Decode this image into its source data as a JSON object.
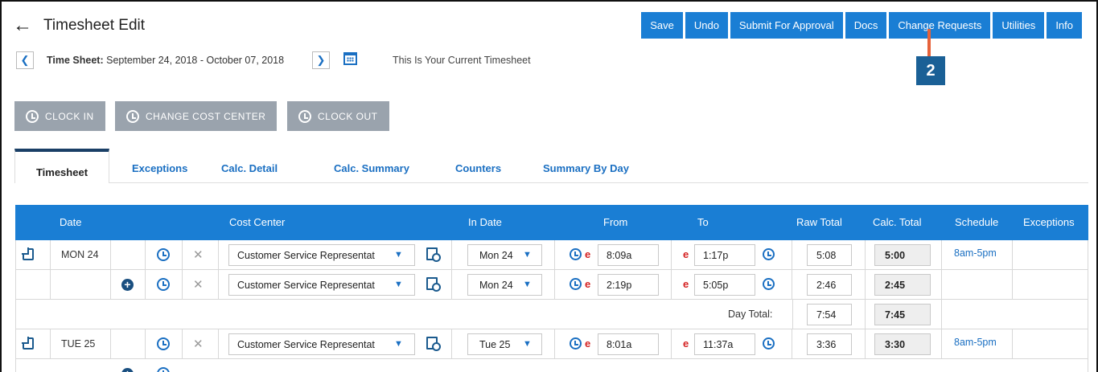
{
  "header": {
    "title": "Timesheet Edit",
    "toolbar": [
      "Save",
      "Undo",
      "Submit For Approval",
      "Docs",
      "Change Requests",
      "Utilities",
      "Info"
    ],
    "callout": "2"
  },
  "timesheet": {
    "label": "Time Sheet:",
    "range": "September 24, 2018 - October 07, 2018",
    "current_text": "This Is Your Current Timesheet"
  },
  "actions": [
    "CLOCK IN",
    "CHANGE COST CENTER",
    "CLOCK OUT"
  ],
  "tabs": [
    "Timesheet",
    "Exceptions",
    "Calc. Detail",
    "Calc. Summary",
    "Counters",
    "Summary By Day"
  ],
  "columns": [
    "Date",
    "Cost Center",
    "In Date",
    "From",
    "To",
    "Raw Total",
    "Calc. Total",
    "Schedule",
    "Exceptions"
  ],
  "rows": [
    {
      "date": "MON 24",
      "cost_center": "Customer Service Representat",
      "in_date": "Mon 24",
      "from": "8:09a",
      "to": "1:17p",
      "raw": "5:08",
      "calc": "5:00",
      "schedule": "8am-5pm"
    },
    {
      "date": "",
      "cost_center": "Customer Service Representat",
      "in_date": "Mon 24",
      "from": "2:19p",
      "to": "5:05p",
      "raw": "2:46",
      "calc": "2:45",
      "schedule": ""
    },
    {
      "date": "TUE 25",
      "cost_center": "Customer Service Representat",
      "in_date": "Tue 25",
      "from": "8:01a",
      "to": "11:37a",
      "raw": "3:36",
      "calc": "3:30",
      "schedule": "8am-5pm"
    }
  ],
  "day_total": {
    "label": "Day Total:",
    "raw": "7:54",
    "calc": "7:45"
  },
  "colors": {
    "accent": "#1a7ed4",
    "badge": "#1a6096",
    "marker": "#e6623a",
    "disabled": "#9aa3ad"
  }
}
